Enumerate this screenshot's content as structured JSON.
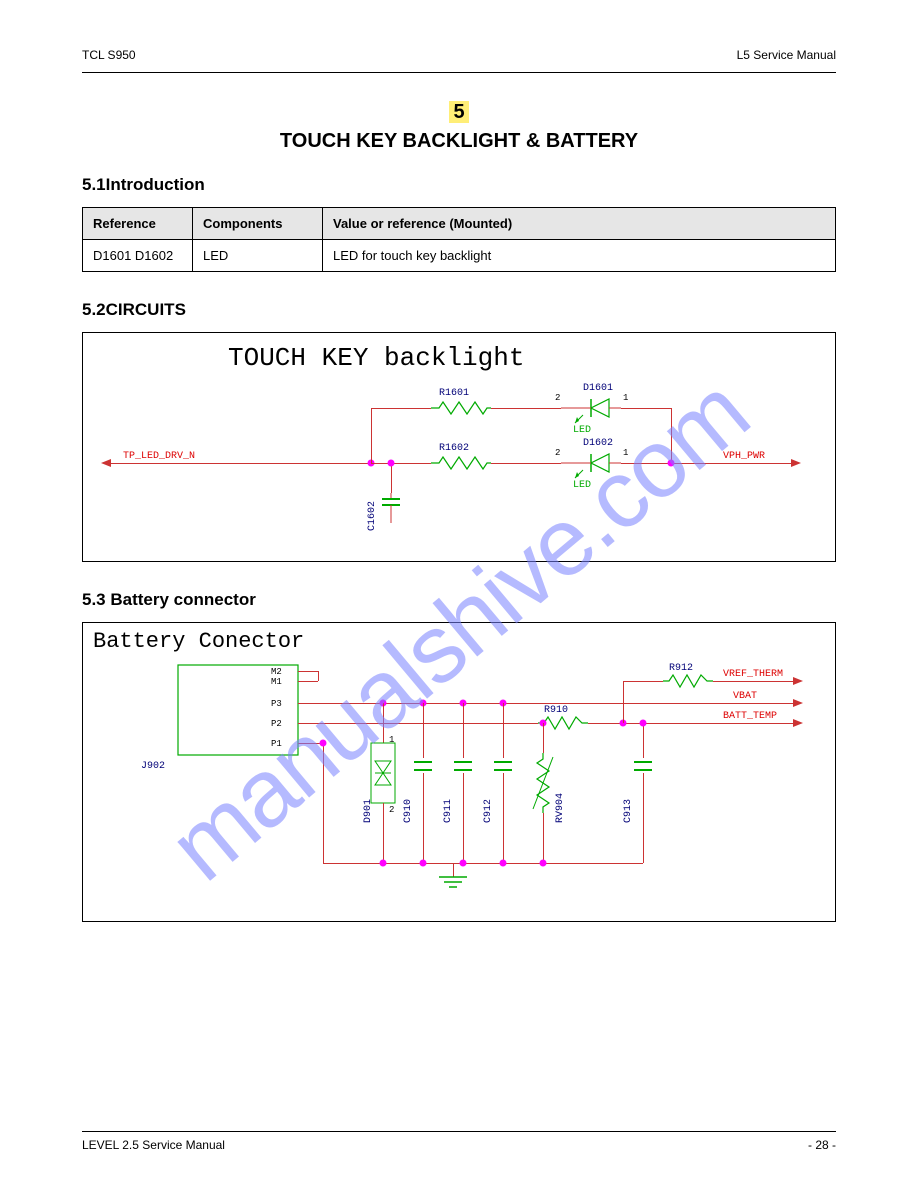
{
  "header": {
    "left": "TCL S950",
    "right": "L5 Service Manual"
  },
  "section_number": "5",
  "main_heading": "TOUCH KEY BACKLIGHT & BATTERY",
  "sub_intro": "5.1Introduction",
  "table": {
    "headers": [
      "Reference",
      "Components",
      "Value or reference (Mounted)"
    ],
    "row": [
      "D1601 D1602",
      "LED",
      "LED for touch key backlight"
    ]
  },
  "caption1": "5.2CIRCUITS",
  "sch1": {
    "title": "TOUCH KEY backlight",
    "nets": {
      "left": "TP_LED_DRV_N",
      "right": "VPH_PWR"
    },
    "refs": {
      "r1": "R1601",
      "r2": "R1602",
      "d1": "D1601",
      "d2": "D1602",
      "c1": "C1602"
    },
    "led_label": "LED"
  },
  "caption2": "5.3 Battery connector",
  "sch2": {
    "title": "Battery Conector",
    "conn": "J902",
    "pins": [
      "M2",
      "M1",
      "P3",
      "P2",
      "P1"
    ],
    "refs": {
      "d": "D901",
      "c1": "C910",
      "c2": "C911",
      "c3": "C912",
      "c4": "C913",
      "rv": "RV904",
      "rtop": "R912",
      "rmid": "R910"
    },
    "nets": {
      "a": "VREF_THERM",
      "b": "VBAT",
      "c": "BATT_TEMP"
    }
  },
  "footer": {
    "left": "LEVEL 2.5 Service Manual",
    "right": "- 28 -"
  }
}
